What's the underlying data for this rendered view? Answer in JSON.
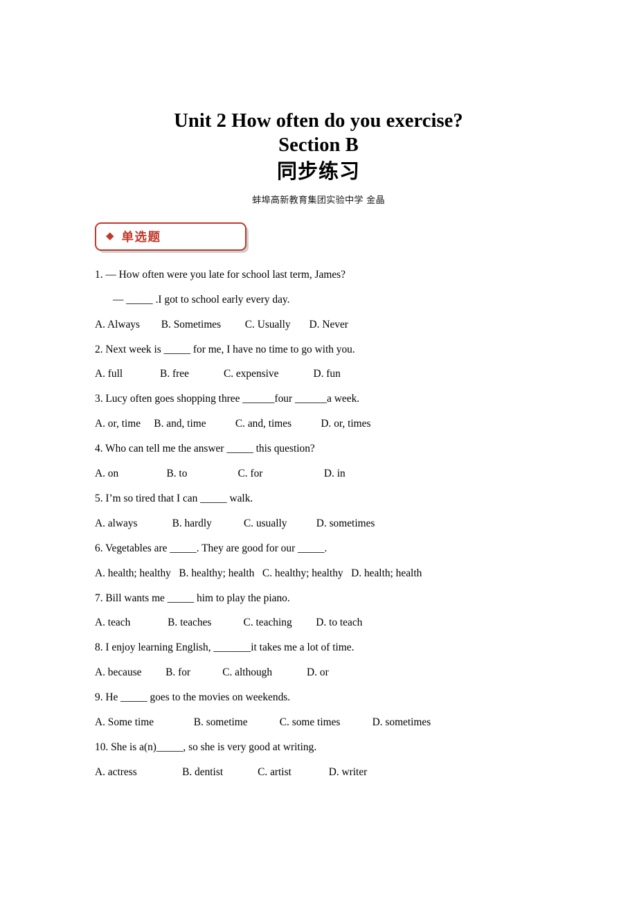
{
  "title": {
    "line1": "Unit 2 How often do you exercise?",
    "line2": "Section B",
    "line3": "同步练习",
    "author": "蚌埠高新教育集团实验中学  金晶"
  },
  "section": {
    "bullet": "◆",
    "label": "单选题",
    "border_color": "#c0392b",
    "text_color": "#c0392b"
  },
  "questions": [
    {
      "stem": "1. — How often were you late for school last term, James?",
      "stem2": "— _____ .I got to school early every day.",
      "options": "A. Always        B. Sometimes         C. Usually       D. Never"
    },
    {
      "stem": "2. Next week is _____ for me, I have no time to go with you.",
      "options": "A. full              B. free             C. expensive             D. fun"
    },
    {
      "stem": "3. Lucy often goes shopping three ______four ______a week.",
      "options": "A. or, time     B. and, time           C. and, times           D. or, times"
    },
    {
      "stem": "4. Who can tell me the answer _____ this question?",
      "options": "A. on                  B. to                   C. for                       D. in"
    },
    {
      "stem": "5. I’m so tired that I can _____ walk.",
      "options": "A. always             B. hardly            C. usually           D. sometimes"
    },
    {
      "stem": "6. Vegetables are _____. They are good for our _____.",
      "options": "A. health; healthy   B. healthy; health   C. healthy; healthy   D. health; health"
    },
    {
      "stem": "7. Bill wants me _____ him to play the piano.",
      "options": "A. teach              B. teaches            C. teaching         D. to teach"
    },
    {
      "stem": "8. I enjoy learning English, _______it takes me a lot of time.",
      "options": "A. because         B. for            C. although             D. or"
    },
    {
      "stem": "9. He _____ goes to the movies on weekends.",
      "options": "A. Some time               B. sometime            C. some times            D. sometimes"
    },
    {
      "stem": "10. She is a(n)_____, so she is very good at writing.",
      "options": "A. actress                 B. dentist             C. artist              D. writer"
    }
  ]
}
